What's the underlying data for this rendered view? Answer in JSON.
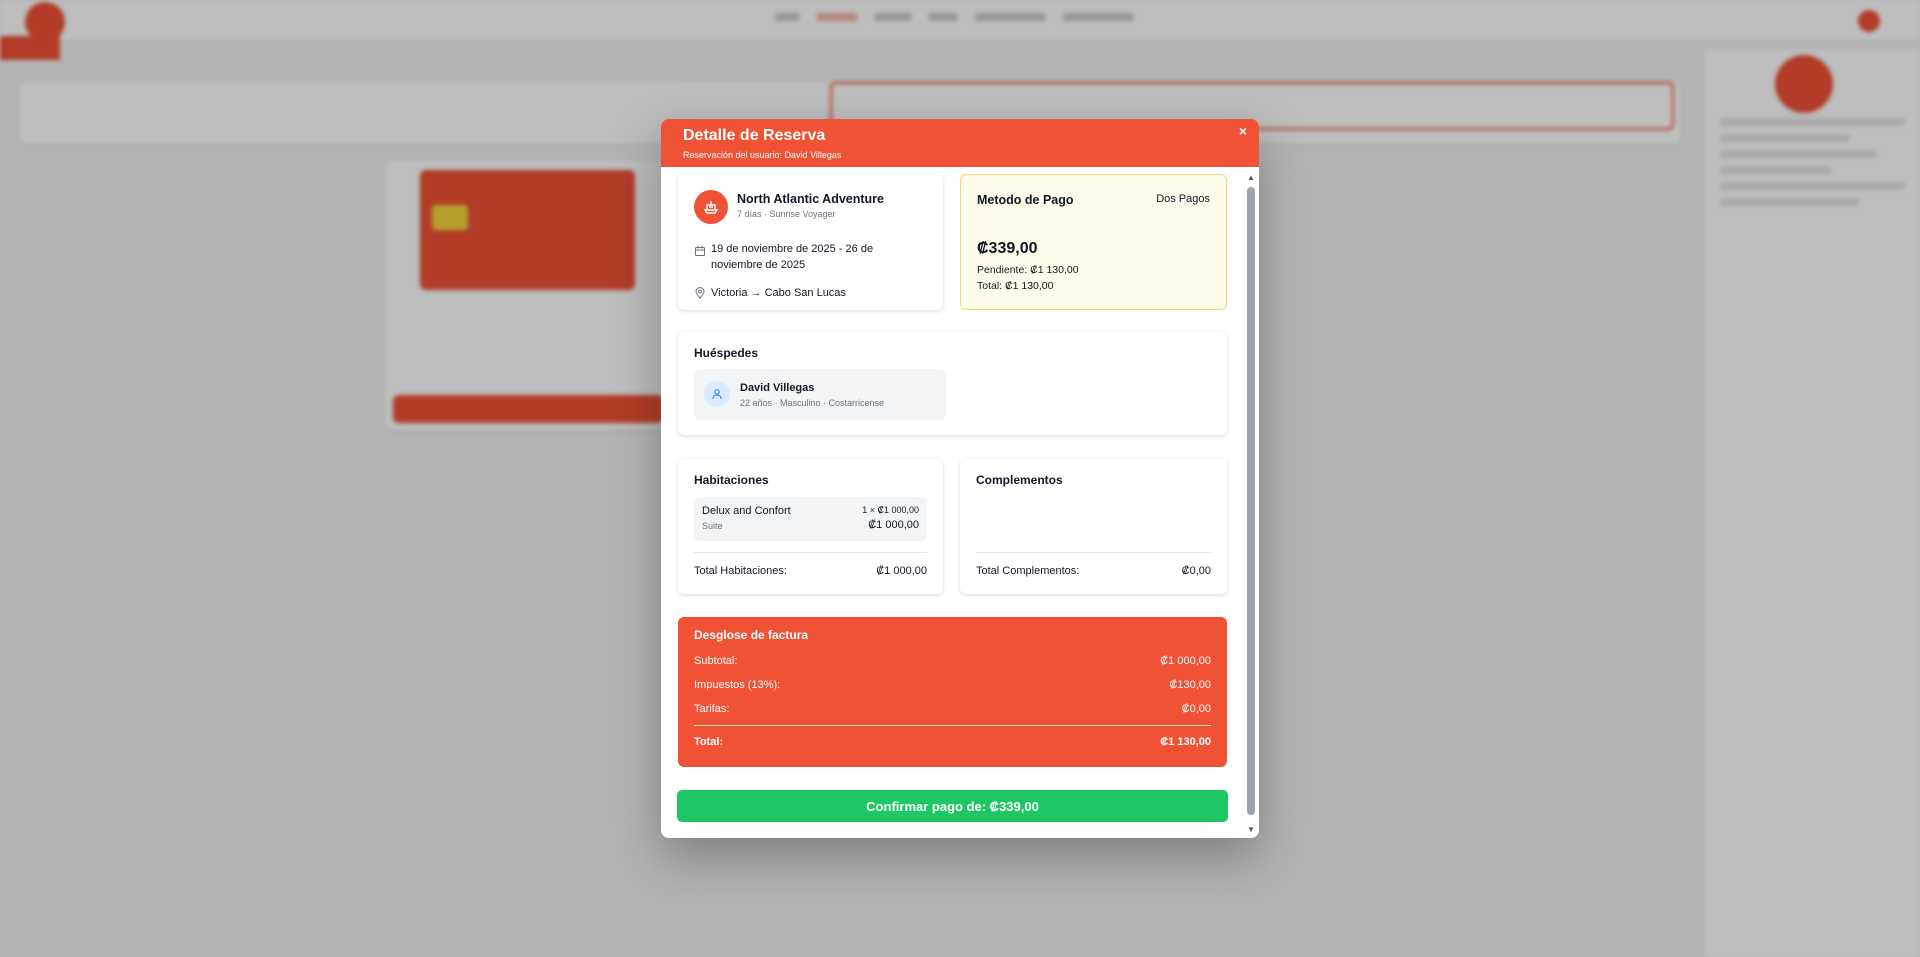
{
  "modal": {
    "title": "Detalle de Reserva",
    "subtitle": "Reservación del usuario: David Villegas",
    "close_label": "×"
  },
  "trip": {
    "name": "North Atlantic Adventure",
    "details": "7 días · Sunrise Voyager",
    "dates": "19 de noviembre de 2025 - 26 de noviembre de 2025",
    "route": "Victoria → Cabo San Lucas"
  },
  "payment": {
    "title": "Metodo de Pago",
    "mode": "Dos Pagos",
    "amount": "₡339,00",
    "pending": "Pendiente: ₡1 130,00",
    "total": "Total: ₡1 130,00"
  },
  "guests": {
    "title": "Huéspedes",
    "items": [
      {
        "name": "David Villegas",
        "info": "22 años · Masculino · Costarricense"
      }
    ]
  },
  "rooms": {
    "title": "Habitaciones",
    "items": [
      {
        "name": "Delux and Confort",
        "type": "Suite",
        "qty": "1 × ₡1 000,00",
        "price": "₡1 000,00"
      }
    ],
    "total_label": "Total Habitaciones:",
    "total_value": "₡1 000,00"
  },
  "extras": {
    "title": "Complementos",
    "total_label": "Total Complementos:",
    "total_value": "₡0,00"
  },
  "invoice": {
    "title": "Desglose de factura",
    "rows": [
      {
        "label": "Subtotal:",
        "value": "₡1 000,00"
      },
      {
        "label": "Impuestos (13%):",
        "value": "₡130,00"
      },
      {
        "label": "Tarifas:",
        "value": "₡0,00"
      }
    ],
    "total_label": "Total:",
    "total_value": "₡1 130,00"
  },
  "confirm_button": "Confirmar pago de: ₡339,00",
  "colors": {
    "accent": "#f05236",
    "confirm": "#1ec665",
    "payment_bg": "#fffbea"
  }
}
